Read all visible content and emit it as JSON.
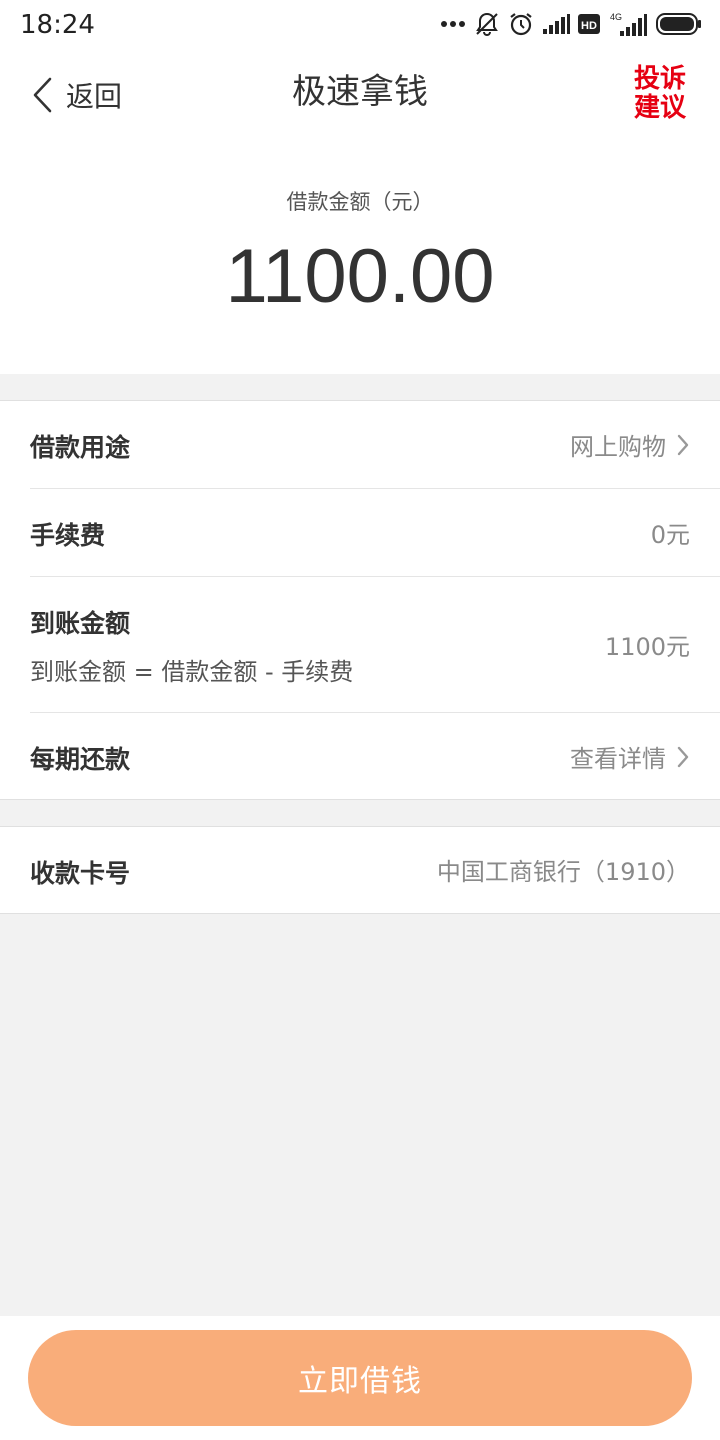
{
  "status_bar": {
    "time": "18:24",
    "network": "4G",
    "hd": "HD",
    "icons": [
      "more-dots-icon",
      "mute-bell-icon",
      "alarm-icon",
      "signal-icon",
      "hd-icon",
      "signal-4g-icon",
      "battery-icon"
    ]
  },
  "nav": {
    "back_label": "返回",
    "title": "极速拿钱",
    "complaint_line1": "投诉",
    "complaint_line2": "建议"
  },
  "amount": {
    "label": "借款金额（元）",
    "value": "1100.00"
  },
  "rows": [
    {
      "title": "借款用途",
      "value": "网上购物"
    },
    {
      "title": "手续费",
      "value": "0元"
    },
    {
      "title": "到账金额",
      "subtitle": "到账金额 = 借款金额 - 手续费",
      "value": "1100元"
    },
    {
      "title": "每期还款",
      "value": "查看详情"
    }
  ],
  "card": {
    "title": "收款卡号",
    "value": "中国工商银行（1910）"
  },
  "button": {
    "label": "立即借钱"
  },
  "colors": {
    "accent_red": "#e60012",
    "button_orange": "#f9ad7a",
    "background": "#f2f2f2",
    "muted_text": "#8a8a8a"
  }
}
